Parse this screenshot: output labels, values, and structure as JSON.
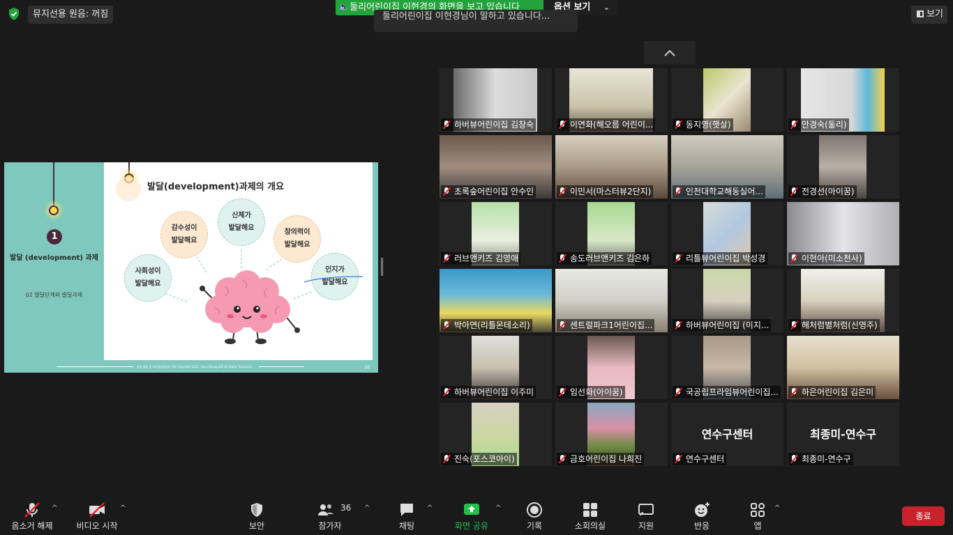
{
  "top": {
    "audio_status": "뮤지선용 원음: 꺼짐",
    "share_banner": "둘리어린이집 이현경의 화면을 보고 있습니다",
    "options_label": "옵션 보기",
    "tooltip": "둘리어린이집 이현경님이 말하고 있습니다...",
    "view_label": "보기"
  },
  "slide": {
    "title": "발달(development)과제의 개요",
    "section_number": "1",
    "section_title": "발달 (development) 과제",
    "section_subtitle": "02 발달단계와 발달과제",
    "bubbles": {
      "b1": "감수성이\n발달해요",
      "b2": "신체가\n발달해요",
      "b3": "창의력이\n발달해요",
      "b4": "사회성이\n발달해요",
      "b5": "인지가\n발달해요"
    },
    "footer_text": "마음 맞춤 첫 1에 발달업무의 이해 Copyright 2021. Hyun Kyung LEE All Rights Reserved.",
    "page_number": "16"
  },
  "participants": {
    "p1": "하버뷰어린이집 김창숙",
    "p2": "이연화(해오름 어린이...",
    "p3": "동지영(햇살)",
    "p4": "안경숙(둘리)",
    "p5": "초록숲어린이집 안수인",
    "p6": "이민서(마스터뷰2단지)",
    "p7": "인천대학교해동실어...",
    "p8": "전경선(아이꿈)",
    "p9": "러브앤키즈 김영애",
    "p10": "송도러브앤키즈 김은하",
    "p11": "리틀뷰어린이집 박성경",
    "p12": "이현아(미소천사)",
    "p13": "박아연(리틀몬테소리)",
    "p14": "센트럴파크1어린이집...",
    "p15": "하버뷰어린이집 (이지...",
    "p16": "해처럼별처럼(신영주)",
    "p17": "하버뷰어린이집 이주미",
    "p18": "임선화(아이꿈)",
    "p19": "국공립프라임뷰어린이집...",
    "p20": "하은어린이집 김은미",
    "p21": "진숙(포스코아이)",
    "p22": "금호어린이집 나희진",
    "p23": "연수구센터",
    "p24": "최종미-연수구",
    "p23_big": "연수구센터",
    "p24_big": "최종미-연수구"
  },
  "toolbar": {
    "unmute": "음소거 해제",
    "start_video": "비디오 시작",
    "security": "보안",
    "participants": "참가자",
    "participant_count": "36",
    "chat": "채팅",
    "share_screen": "화면 공유",
    "record": "기록",
    "breakout": "소회의실",
    "support": "지원",
    "reactions": "반응",
    "apps": "앱",
    "end": "종료"
  },
  "colors": {
    "share_green": "#23a33b",
    "end_red": "#c8232c",
    "slide_teal": "#7ec8bd"
  }
}
